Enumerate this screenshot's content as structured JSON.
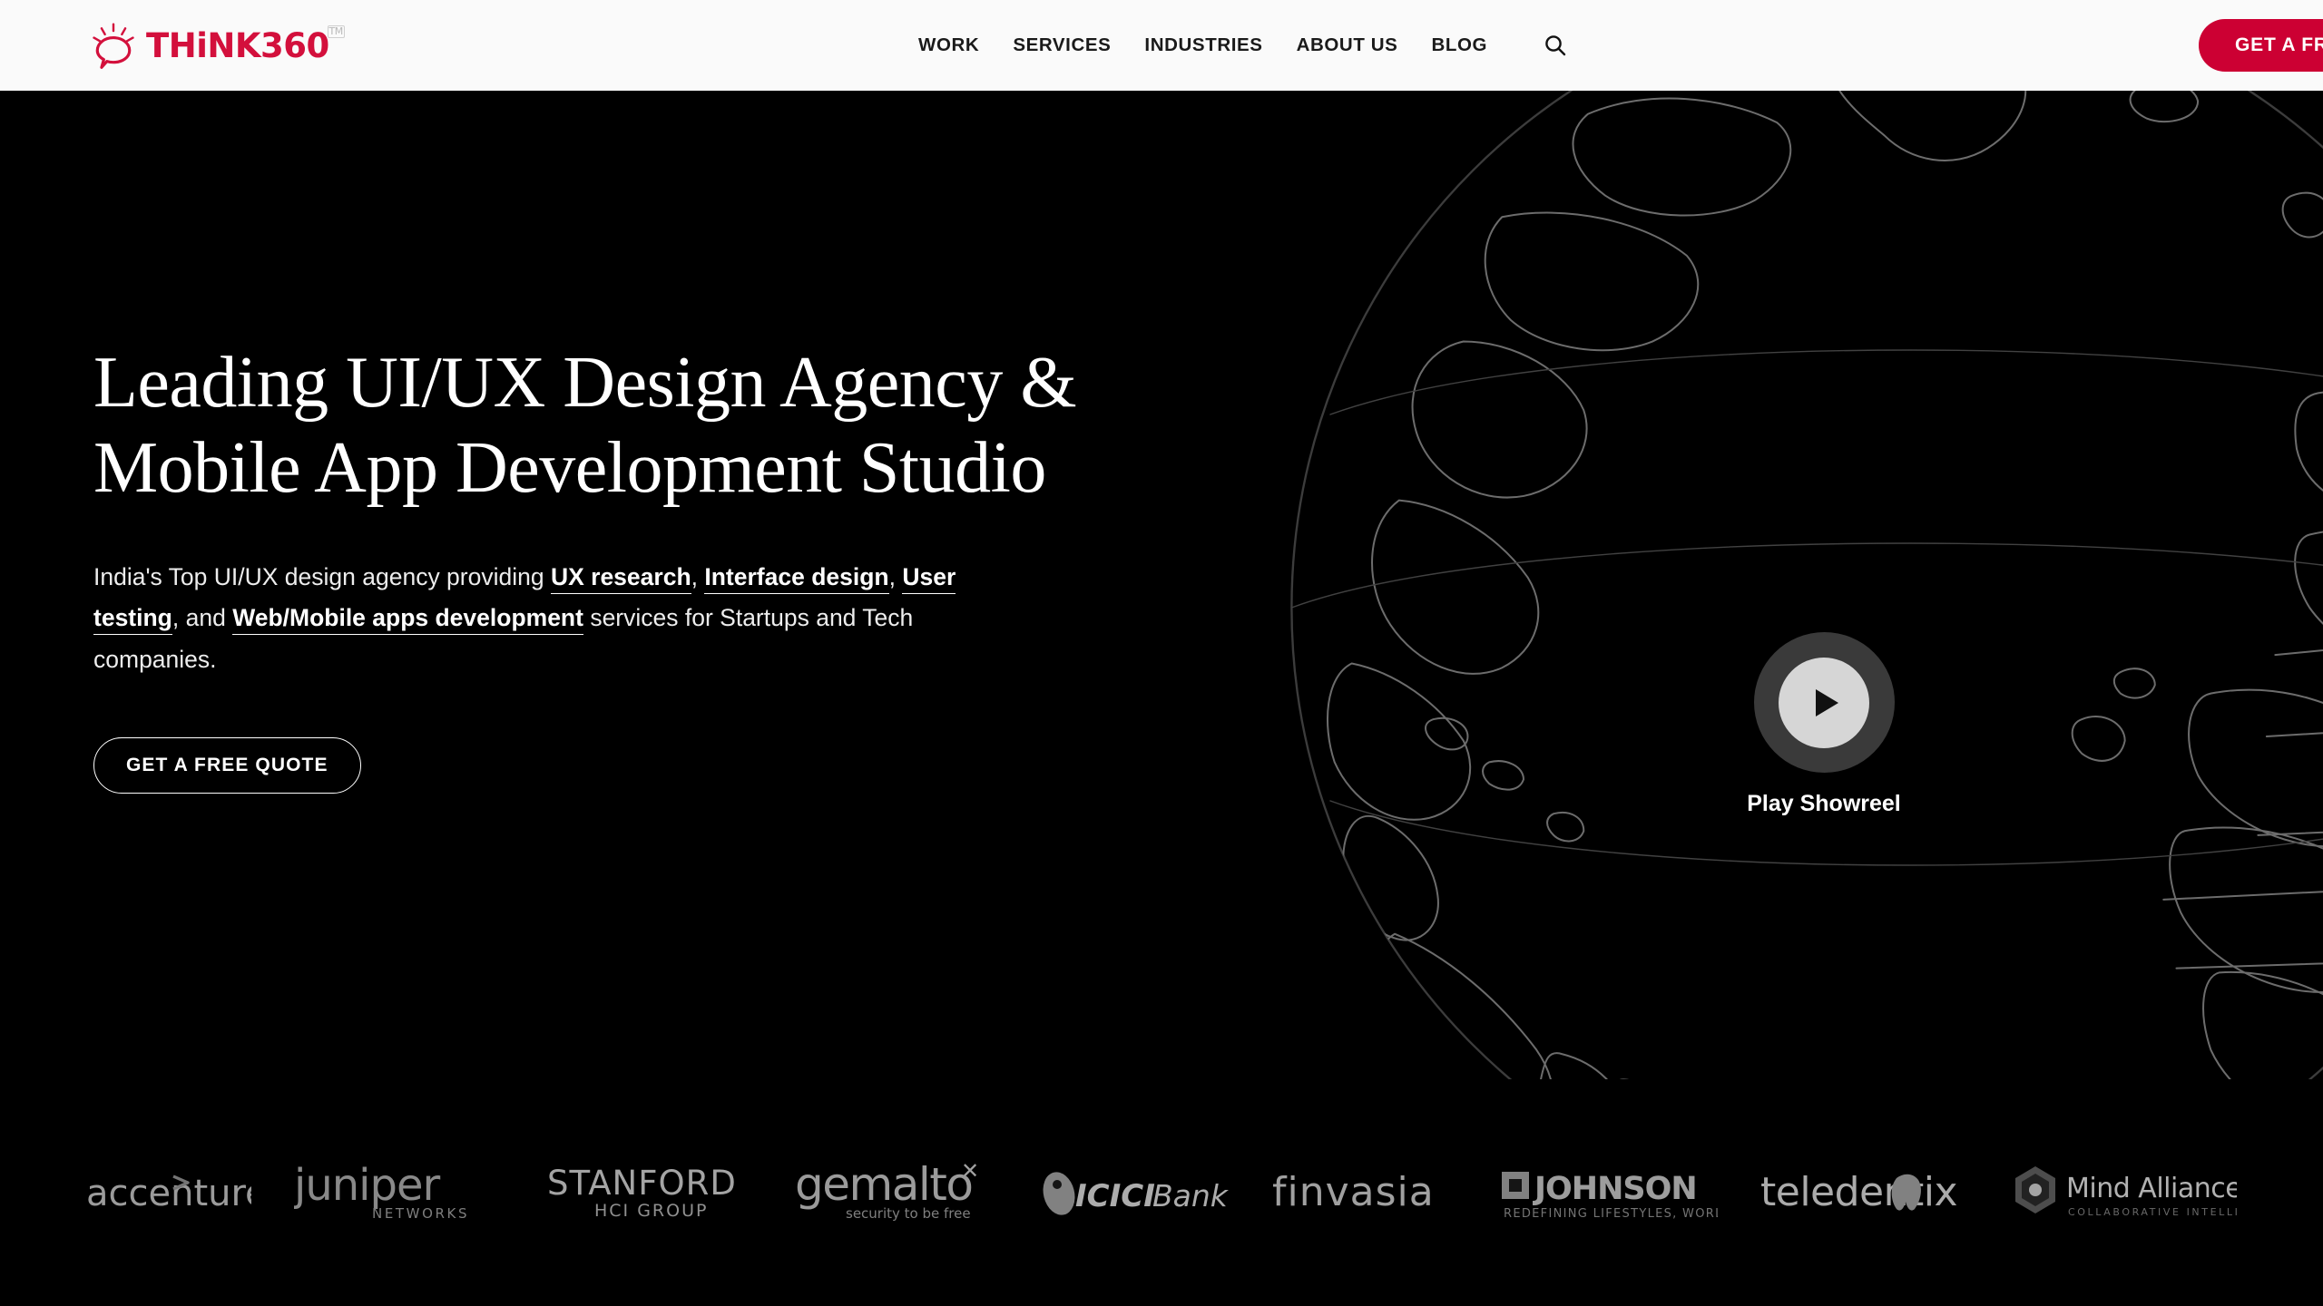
{
  "brand": {
    "name": "THiNK360",
    "tm": "TM",
    "logo_icon": "sun-speech-bubble-icon",
    "accent_color": "#d3103c",
    "cta_color": "#cc0033"
  },
  "header": {
    "background": "#fafafa",
    "nav": [
      {
        "label": "WORK",
        "name": "nav-item-work"
      },
      {
        "label": "SERVICES",
        "name": "nav-item-services"
      },
      {
        "label": "INDUSTRIES",
        "name": "nav-item-industries"
      },
      {
        "label": "ABOUT US",
        "name": "nav-item-about-us"
      },
      {
        "label": "BLOG",
        "name": "nav-item-blog"
      }
    ],
    "search_icon": "search-icon",
    "cta_label": "GET A FREE QUOTE"
  },
  "hero": {
    "background": "#000000",
    "title": "Leading UI/UX Design Agency & Mobile App Development Studio",
    "subtitle_parts": [
      {
        "text": "India's Top UI/UX design agency providing ",
        "bold": false
      },
      {
        "text": "UX research",
        "bold": true
      },
      {
        "text": ", ",
        "bold": false
      },
      {
        "text": "Interface design",
        "bold": true
      },
      {
        "text": ", ",
        "bold": false
      },
      {
        "text": "User testing",
        "bold": true
      },
      {
        "text": ", and ",
        "bold": false
      },
      {
        "text": "Web/Mobile apps development",
        "bold": true
      },
      {
        "text": " services for Startups and Tech companies.",
        "bold": false
      }
    ],
    "cta_label": "GET A FREE QUOTE",
    "background_graphic": "wireframe-globe",
    "showreel": {
      "label": "Play Showreel",
      "icon": "play-icon",
      "ring_color": "#3a3a3a",
      "core_color": "#d6d6d6"
    }
  },
  "clients": {
    "logos": [
      {
        "name": "client-logo-accenture",
        "label": "accenture",
        "sublabel": ""
      },
      {
        "name": "client-logo-juniper-networks",
        "label": "juniper",
        "sublabel": "NETWORKS"
      },
      {
        "name": "client-logo-stanford-hci-group",
        "label": "STANFORD",
        "sublabel": "HCI GROUP"
      },
      {
        "name": "client-logo-gemalto",
        "label": "gemalto",
        "sublabel": "security to be free"
      },
      {
        "name": "client-logo-icici-bank",
        "label": "ICICI Bank",
        "sublabel": ""
      },
      {
        "name": "client-logo-finvasia",
        "label": "finvasia",
        "sublabel": ""
      },
      {
        "name": "client-logo-johnson",
        "label": "JOHNSON",
        "sublabel": "REDEFINING LIFESTYLES, WORLDWIDE."
      },
      {
        "name": "client-logo-teledentix",
        "label": "teledentix",
        "sublabel": ""
      },
      {
        "name": "client-logo-mind-alliance",
        "label": "Mind Alliance",
        "sublabel": "COLLABORATIVE INTELLIGENCE"
      }
    ]
  }
}
